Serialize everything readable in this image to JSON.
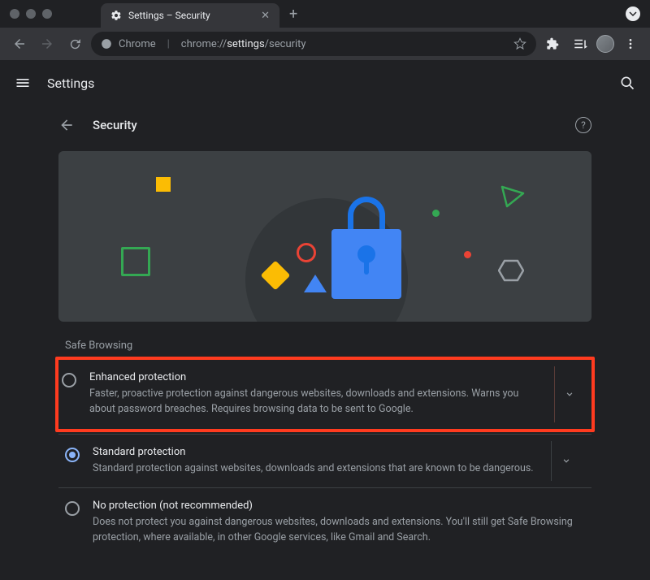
{
  "tab": {
    "title": "Settings – Security"
  },
  "omnibox": {
    "host": "Chrome",
    "url_prefix": "chrome://",
    "url_bold": "settings",
    "url_suffix": "/security"
  },
  "settings_header": {
    "title": "Settings"
  },
  "section": {
    "title": "Security",
    "group_label": "Safe Browsing"
  },
  "options": [
    {
      "title": "Enhanced protection",
      "desc": "Faster, proactive protection against dangerous websites, downloads and extensions. Warns you about password breaches. Requires browsing data to be sent to Google.",
      "selected": false,
      "expandable": true,
      "highlight": true
    },
    {
      "title": "Standard protection",
      "desc": "Standard protection against websites, downloads and extensions that are known to be dangerous.",
      "selected": true,
      "expandable": true,
      "highlight": false
    },
    {
      "title": "No protection (not recommended)",
      "desc": "Does not protect you against dangerous websites, downloads and extensions. You'll still get Safe Browsing protection, where available, in other Google services, like Gmail and Search.",
      "selected": false,
      "expandable": false,
      "highlight": false
    }
  ]
}
